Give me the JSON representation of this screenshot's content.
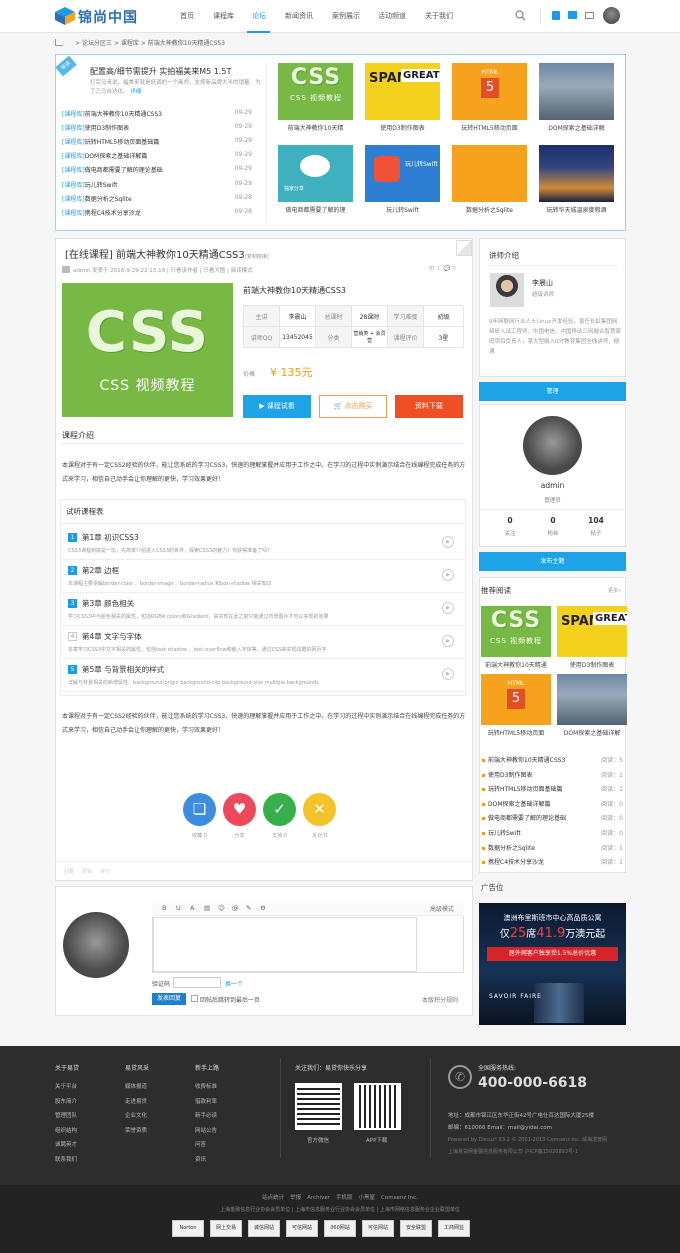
{
  "header": {
    "brand": "锦尚中国",
    "nav": [
      "首页",
      "课程库",
      "论坛",
      "新闻资讯",
      "案例展示",
      "活动频道",
      "关于我们"
    ],
    "active": "论坛"
  },
  "breadcrumb": {
    "items": [
      "论坛分区三",
      "课程库",
      "前端大神教你10天精通CSS3"
    ],
    "sep": ">"
  },
  "featured": {
    "tag": "导读",
    "title": "配置高/细节需提升 实拍福美来M5 1.5T",
    "desc": "打完马来说，福美来就是低调的一个画师，支撑新品牌大半的销量。为了乙马自达化。",
    "more": "详细"
  },
  "news": [
    {
      "cat": "[课程库]",
      "title": "前端大神教你10天精通CSS3",
      "date": "09-29"
    },
    {
      "cat": "[课程库]",
      "title": "使用D3制作图表",
      "date": "09-29"
    },
    {
      "cat": "[课程库]",
      "title": "玩转HTML5移动页面基础篇",
      "date": "09-29"
    },
    {
      "cat": "[课程库]",
      "title": "DOM探索之基础详解篇",
      "date": "09-29"
    },
    {
      "cat": "[课程库]",
      "title": "做电商都需要了解的理论基础",
      "date": "09-29"
    },
    {
      "cat": "[课程库]",
      "title": "玩儿转Swift",
      "date": "09-29"
    },
    {
      "cat": "[课程库]",
      "title": "数据分析之Sqlite",
      "date": "09-28"
    },
    {
      "cat": "[课程库]",
      "title": "携程C4技术分享沙龙",
      "date": "09-28"
    }
  ],
  "thumbs": [
    {
      "cap": "前端大神教你10天精",
      "kind": "css"
    },
    {
      "cap": "使用D3制作图表",
      "kind": "spam"
    },
    {
      "cap": "玩转HTML5移动页面",
      "kind": "html5"
    },
    {
      "cap": "DOM探索之基础详解",
      "kind": "city"
    },
    {
      "cap": "做电商都需要了解的理",
      "kind": "ppl"
    },
    {
      "cap": "玩儿转Swift",
      "kind": "swift"
    },
    {
      "cap": "数据分析之Sqlite",
      "kind": "db"
    },
    {
      "cap": "玩转华天城温泉度假酒",
      "kind": "bkk"
    }
  ],
  "thumb_text": {
    "css_big": "CSS",
    "css_small": "CSS 视频教程",
    "spam_big": "SPAM",
    "spam_great": "GREAT!",
    "html5": "HTML",
    "html5_num": "5",
    "swift": "Swift",
    "swift_zh": "玩儿转Swift",
    "ppl": "独家分享"
  },
  "post": {
    "title": "[在线课程] 前端大神教你10天精通CSS3",
    "copy": "[复制链接]",
    "meta": "admin 发表于 2016-9-29 22:13:19 | 只看该作者 | 只看大图 | 阅读模式",
    "views": "1",
    "replies": "0",
    "course_name": "前端大神教你10天精通CSS3",
    "table": [
      [
        "主讲",
        "李晨山",
        "总课时",
        "28课时",
        "学习难度",
        "初级"
      ],
      [
        "讲师QQ",
        "13452045",
        "分类",
        "营销类 + 会员营",
        "课程评价",
        "3星"
      ]
    ],
    "price_label": "价格",
    "price": "¥ 135元",
    "buttons": [
      "课程试看",
      "点击购买",
      "资料下载"
    ],
    "intro_title": "课程介绍",
    "intro": "本课程对于有一定CSS2经验的伙伴，能让您系统的学习CSS3，快速的理解掌握并应用于工作之中。在学习的过程中实例演示结合在线编程完成任务的方式来学习，相信自己动手会让你理解的更快，学习效果更好！",
    "intro2": "本课程对于有一定CSS2经验的伙伴，能让您系统的学习CSS3，快速的理解掌握并应用于工作之中。在学习的过程中实例演示结合在线编程完成任务的方式来学习，相信自己动手会让你理解的更快，学习效果更好！",
    "lessons_title": "试听课程表",
    "lessons": [
      {
        "n": "1",
        "t": "第1章 初识CSS3",
        "d": "CSS3课程到底是一坛，先简单介绍进入CSS3的世界，探索CSS3的魅力！你获得准备了吗？"
      },
      {
        "n": "2",
        "t": "第2章 边框",
        "d": "本课程主要讲解border-color 、border-image 、border-radius 和box-shadow 相关知识"
      },
      {
        "n": "3",
        "t": "第3章 颜色相关",
        "d": "学习CSS3中与颜色相关的属性，包括RGBA colors和Gradient，来实现在此之前只能通过背景图片才可以实现的效果"
      },
      {
        "n": "4",
        "t": "第4章 文字与字体",
        "d": "本章学习CSS3中文字相关的属性，包括text-shadow 、text-overflow和嵌入字体等，通过CSS来实现炫酷的网页字"
      },
      {
        "n": "5",
        "t": "第5章 与背景相关的样式",
        "d": "详解与背景相关的新增属性：background-origin background-clip background-size multiple backgrounds"
      }
    ],
    "actions": [
      {
        "icon": "❏",
        "label": "收藏 0",
        "color": "#3d8de0"
      },
      {
        "icon": "♥",
        "label": "分享",
        "color": "#ec4a5a"
      },
      {
        "icon": "✓",
        "label": "支持 0",
        "color": "#35b04a"
      },
      {
        "icon": "✕",
        "label": "反对 0",
        "color": "#f3c328"
      }
    ],
    "footer_links": [
      "回复",
      "举报",
      "评分"
    ]
  },
  "reply": {
    "mode": "高级模式",
    "captcha_label": "验证码",
    "captcha_change": "换一个",
    "submit": "发表回复",
    "checkbox": "回帖后跳转到最后一页",
    "rules": "本版积分规则",
    "tools": [
      "B",
      "U",
      "A",
      "▤",
      "☺",
      "@",
      "✎",
      "⚙"
    ]
  },
  "teacher": {
    "section": "讲师介绍",
    "name": "李晨山",
    "role": "超级讲师",
    "bio": "9年网联网行业人士Linux开发经验，曾任长虹集团网络研入试工程师，中国电信、中国移动三网融合智慧家庭项目负责人，某大型融入IOT教育集团全栈讲师，精通"
  },
  "manage": "管理",
  "admin": {
    "name": "admin",
    "role": "管理员",
    "stats": [
      {
        "v": "0",
        "k": "关注"
      },
      {
        "v": "0",
        "k": "粉丝"
      },
      {
        "v": "104",
        "k": "帖子"
      }
    ]
  },
  "post_topic": "发布主题",
  "recommend": {
    "title": "推荐阅读",
    "more": "更多»",
    "thumbs": [
      {
        "cap": "前端大神教你10天精通",
        "kind": "css"
      },
      {
        "cap": "使用D3制作图表",
        "kind": "spam"
      },
      {
        "cap": "玩转HTML5移动页面",
        "kind": "html5"
      },
      {
        "cap": "DOM探索之基础详解",
        "kind": "city"
      }
    ],
    "list": [
      {
        "t": "前端大神教你10天精通CSS3",
        "r": "阅读：5"
      },
      {
        "t": "使用D3制作图表",
        "r": "阅读：1"
      },
      {
        "t": "玩转HTML5移动页面基础篇",
        "r": "阅读：1"
      },
      {
        "t": "DOM探索之基础详解篇",
        "r": "阅读：0"
      },
      {
        "t": "做电商都需要了解的理论基础",
        "r": "阅读：0"
      },
      {
        "t": "玩儿转Swift",
        "r": "阅读：0"
      },
      {
        "t": "数据分析之Sqlite",
        "r": "阅读：1"
      },
      {
        "t": "携程C4技术分享沙龙",
        "r": "阅读：1"
      }
    ]
  },
  "ad": {
    "label": "广告位",
    "l1": "澳洲布里斯班市中心高品质公寓",
    "l2a": "仅",
    "l2b": "25",
    "l2c": "席",
    "l2d": "41.9",
    "l2e": "万澳元起",
    "l3": "居外网客户独享受1.5%总价优惠",
    "brand": "SAVOIR FAIRE"
  },
  "footer": {
    "cols": [
      {
        "h": "关于易贷",
        "items": [
          "关于平台",
          "股东简介",
          "管理团队",
          "组织结构",
          "诚聘英才",
          "联系我们"
        ]
      },
      {
        "h": "易贷风采",
        "items": [
          "媒体报道",
          "走进易贷",
          "企业文化",
          "荣誉资质"
        ]
      },
      {
        "h": "新手上路",
        "items": [
          "收费标准",
          "借款利率",
          "新手必读",
          "网站公告",
          "问答",
          "资讯"
        ]
      }
    ],
    "follow": "关注我们：易贷你快乐分享",
    "qr1": "官方微信",
    "qr2": "APP下载",
    "hotline_label": "全国服务热线:",
    "hotline": "400-000-6618",
    "address": "地址：成都市锦江区东华正街42号广电仕百达国际大厦25楼",
    "email": "邮编：610066 Email：mail@yidai.com",
    "powered": "Powered by Discuz! X3.2 © 2001-2013 Comsenz Inc. 威海湛普网",
    "copyright": "上海易贷网金融信息服务有限公司 沪ICP备15020893号-1",
    "links": [
      "站点统计",
      "举报",
      "Archiver",
      "手机版",
      "小黑屋",
      "Comsenz Inc."
    ],
    "assoc": "上海金融信息行业协会会员单位 | 上海市信息服务业行业协会会员单位 | 上海市网络信息服务业企业联盟单位",
    "badges": [
      "Norton",
      "网上交易",
      "诚信网站",
      "可信网站",
      "360网站",
      "可信网站",
      "安全联盟",
      "工商网监"
    ]
  }
}
